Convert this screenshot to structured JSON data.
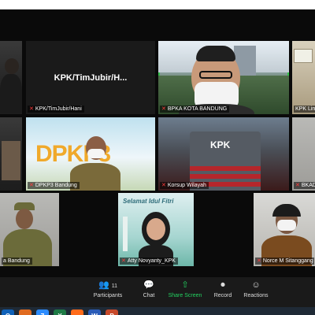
{
  "tiles": {
    "t1": {
      "name": ""
    },
    "t2": {
      "name": "KPK/TimJubir/Hani",
      "center": "KPK/TimJubir/H..."
    },
    "t3": {
      "name": "BPKA KOTA BANDUNG"
    },
    "t4": {
      "name": "KPK Lindi"
    },
    "t5": {
      "name": ""
    },
    "t6": {
      "name": "DPKP3 Bandung",
      "logo": "DPKP3"
    },
    "t7": {
      "name": "Korsup Wilayah",
      "building_sign": "KPK"
    },
    "t8": {
      "name": "BKAD"
    },
    "t9": {
      "name": "a Bandung"
    },
    "t10": {
      "name": "Atty Novyanty_KPK",
      "banner": "Selamat Idul Fitri"
    },
    "t11": {
      "name": "Norce M Sitanggang"
    }
  },
  "controls": {
    "participants": {
      "label": "Participants",
      "count": "11",
      "icon": "participants-icon"
    },
    "chat": {
      "label": "Chat",
      "icon": "chat-icon"
    },
    "share": {
      "label": "Share Screen",
      "icon": "share-screen-icon"
    },
    "record": {
      "label": "Record",
      "icon": "record-icon"
    },
    "reactions": {
      "label": "Reactions",
      "icon": "reactions-icon"
    }
  },
  "taskbar": {
    "apps": [
      "O",
      "◐",
      "Z",
      "X",
      "●",
      "W",
      "P"
    ]
  },
  "colors": {
    "accent_green": "#23d160",
    "mic_off_red": "#ff3b3b",
    "speaking_outline": "#33c24a"
  }
}
